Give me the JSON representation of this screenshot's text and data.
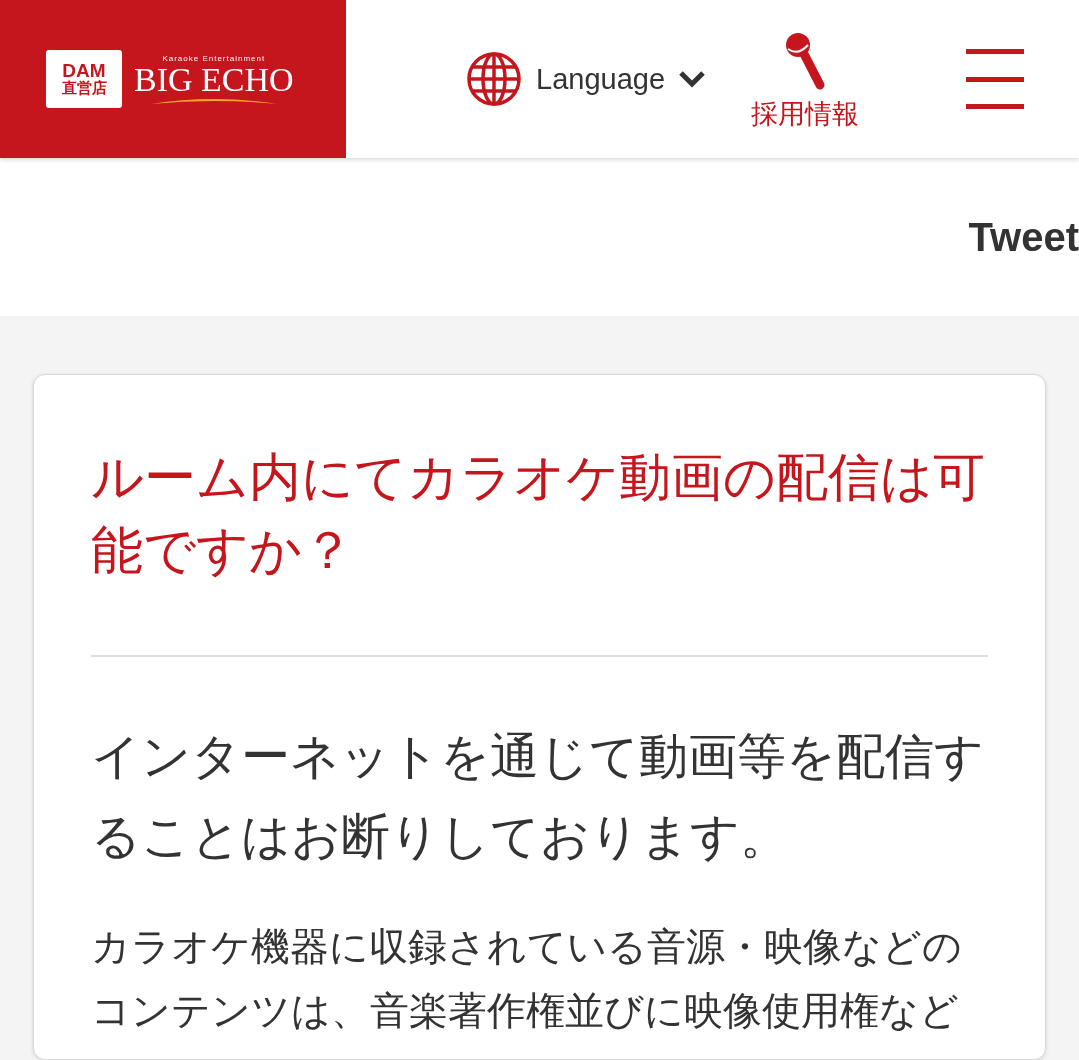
{
  "header": {
    "logo": {
      "badge_top": "DAM",
      "badge_bottom": "直営店",
      "tagline": "Karaoke Entertainment",
      "brand": "BIG ECHO"
    },
    "language": {
      "label": "Language"
    },
    "recruit": {
      "label": "採用情報"
    }
  },
  "share": {
    "label": "Tweet"
  },
  "faq": {
    "question": "ルーム内にてカラオケ動画の配信は可能ですか？",
    "answer_lead": "インターネットを通じて動画等を配信することはお断りしております。",
    "answer_body": "カラオケ機器に収録されている音源・映像などのコンテンツは、音楽著作権並びに映像使用権など"
  }
}
